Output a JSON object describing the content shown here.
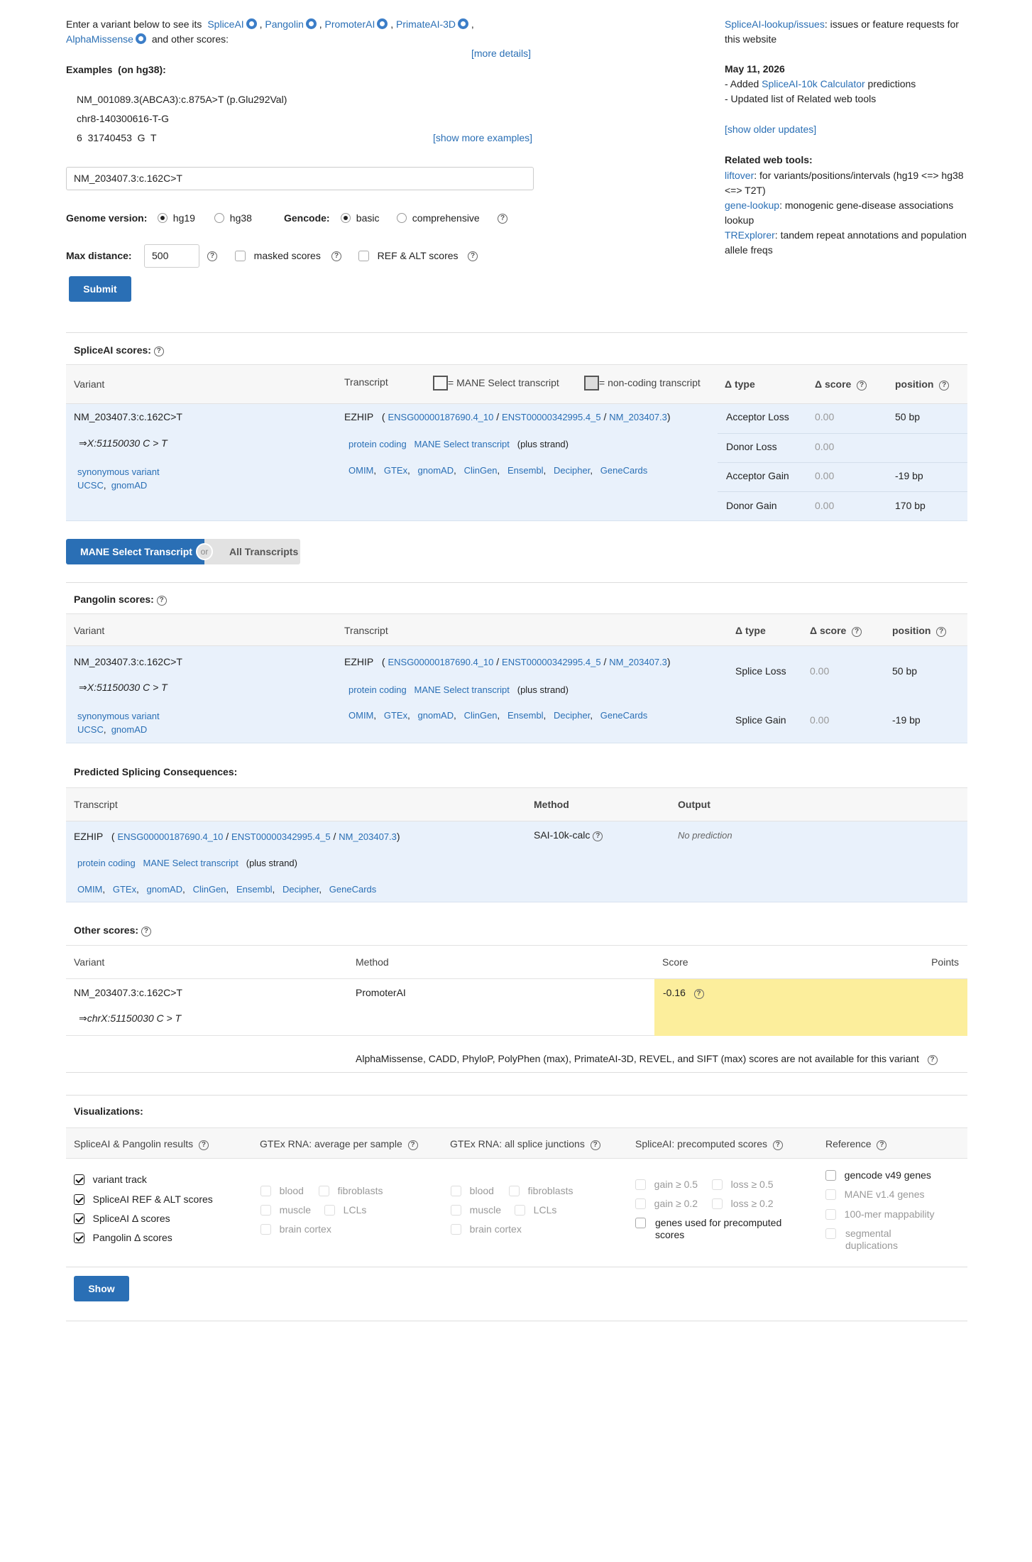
{
  "intro": {
    "prefix": "Enter a variant below to see its",
    "tools": [
      "SpliceAI",
      "Pangolin",
      "PromoterAI",
      "PrimateAI-3D",
      "AlphaMissense"
    ],
    "suffix": "and other scores:",
    "more_details": "[more details]"
  },
  "examples": {
    "title": "Examples",
    "subtitle": "(on hg38):",
    "items": [
      "NM_001089.3(ABCA3):c.875A>T (p.Glu292Val)",
      "chr8-140300616-T-G",
      "6  31740453  G  T"
    ],
    "show_more": "[show more examples]"
  },
  "search": {
    "value": "NM_203407.3:c.162C>T"
  },
  "options": {
    "genome_label": "Genome version:",
    "genome_opts": [
      "hg19",
      "hg38"
    ],
    "gencode_label": "Gencode:",
    "gencode_opts": [
      "basic",
      "comprehensive"
    ],
    "maxdist_label": "Max distance:",
    "maxdist_value": "500",
    "masked_label": "masked scores",
    "refalt_label": "REF & ALT scores",
    "submit": "Submit"
  },
  "sidebar": {
    "issues_link": "SpliceAI-lookup/issues",
    "issues_text": ": issues or feature requests for this website",
    "date": "May 11, 2026",
    "update1_prefix": "- Added ",
    "update1_link": "SpliceAI-10k Calculator",
    "update1_suffix": " predictions",
    "update2": "- Updated list of Related web tools",
    "older": "[show older updates]",
    "related_title": "Related web tools:",
    "tools": [
      {
        "link": "liftover",
        "text": ": for variants/positions/intervals (hg19 <=> hg38 <=> T2T)"
      },
      {
        "link": "gene-lookup",
        "text": ": monogenic gene-disease associations lookup"
      },
      {
        "link": "TRExplorer",
        "text": ": tandem repeat annotations and population allele freqs"
      }
    ]
  },
  "spliceai": {
    "title": "SpliceAI scores:",
    "headers": {
      "variant": "Variant",
      "transcript": "Transcript",
      "mane_legend": "= MANE Select transcript",
      "noncoding_legend": "= non-coding transcript",
      "dtype": "Δ type",
      "dscore": "Δ score",
      "position": "position"
    },
    "rows": [
      {
        "type": "Acceptor Loss",
        "score": "0.00",
        "pos": "50 bp"
      },
      {
        "type": "Donor Loss",
        "score": "0.00",
        "pos": ""
      },
      {
        "type": "Acceptor Gain",
        "score": "0.00",
        "pos": "-19 bp"
      },
      {
        "type": "Donor Gain",
        "score": "0.00",
        "pos": "170 bp"
      }
    ]
  },
  "variant": {
    "name": "NM_203407.3:c.162C>T",
    "coord": "⇒X:51150030 C > T",
    "consequence": "synonymous variant",
    "link_ucsc": "UCSC",
    "link_gnomad": "gnomAD"
  },
  "transcript": {
    "gene": "EZHIP",
    "ensg": "ENSG00000187690.4_10",
    "enst": "ENST00000342995.4_5",
    "nm": "NM_203407.3",
    "biotype": "protein coding",
    "mane": "MANE Select transcript",
    "strand": "(plus strand)",
    "links": [
      "OMIM",
      "GTEx",
      "gnomAD",
      "ClinGen",
      "Ensembl",
      "Decipher",
      "GeneCards"
    ]
  },
  "toggle": {
    "mane": "MANE Select Transcript",
    "or": "or",
    "all": "All Transcripts"
  },
  "pangolin": {
    "title": "Pangolin scores:",
    "headers": {
      "variant": "Variant",
      "transcript": "Transcript",
      "dtype": "Δ type",
      "dscore": "Δ score",
      "position": "position"
    },
    "rows": [
      {
        "type": "Splice Loss",
        "score": "0.00",
        "pos": "50 bp"
      },
      {
        "type": "Splice Gain",
        "score": "0.00",
        "pos": "-19 bp"
      }
    ]
  },
  "consequences": {
    "title": "Predicted Splicing Consequences:",
    "headers": {
      "transcript": "Transcript",
      "method": "Method",
      "output": "Output"
    },
    "method": "SAI-10k-calc",
    "output": "No prediction"
  },
  "other": {
    "title": "Other scores:",
    "headers": {
      "variant": "Variant",
      "method": "Method",
      "score": "Score",
      "points": "Points"
    },
    "coord": "⇒chrX:51150030 C > T",
    "method": "PromoterAI",
    "score": "-0.16",
    "note": "AlphaMissense,  CADD,  PhyloP,  PolyPhen (max),  PrimateAI-3D,  REVEL,  and SIFT (max) scores are not available for this variant",
    "score_color": "#fcee9c"
  },
  "viz": {
    "title": "Visualizations:",
    "cols": [
      "SpliceAI & Pangolin results",
      "GTEx RNA: average per sample",
      "GTEx RNA: all splice junctions",
      "SpliceAI: precomputed scores",
      "Reference"
    ],
    "results": [
      "variant track",
      "SpliceAI REF & ALT scores",
      "SpliceAI Δ  scores",
      "Pangolin Δ  scores"
    ],
    "gtex": [
      "blood",
      "fibroblasts",
      "muscle",
      "LCLs",
      "brain cortex"
    ],
    "precomp": [
      "gain ≥ 0.5",
      "loss ≥ 0.5",
      "gain ≥ 0.2",
      "loss ≥ 0.2",
      "genes used for precomputed scores"
    ],
    "reference": [
      "gencode v49 genes",
      "MANE v1.4 genes",
      "100-mer mappability",
      "segmental duplications"
    ],
    "show": "Show"
  },
  "colors": {
    "accent": "#2a6fb5",
    "table_bg": "#e9f1fb",
    "header_bg": "#f7f7f7"
  }
}
